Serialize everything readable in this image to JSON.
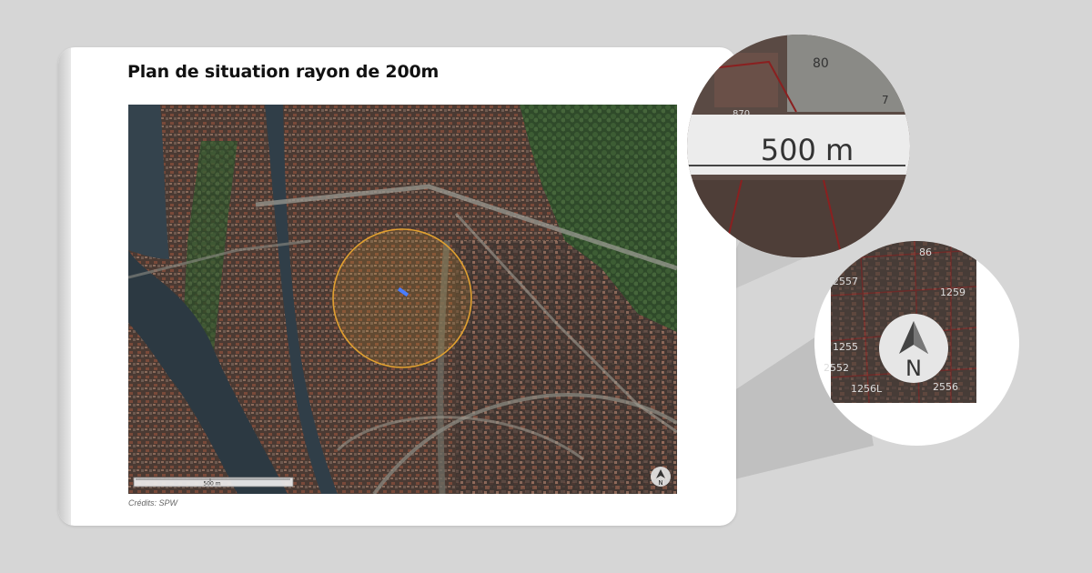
{
  "title": "Plan de situation rayon de 200m",
  "credits": "Crédits: SPW",
  "map": {
    "scale_label": "500 m",
    "north_label": "N",
    "radius_circle_color": "#e0a030",
    "highlight_color": "#4a7dff"
  },
  "zoom_scale": {
    "scale_label": "500 m",
    "parcel_labels": [
      "80",
      "7",
      "870"
    ]
  },
  "zoom_north": {
    "north_label": "N",
    "parcel_labels": [
      "86",
      "2557",
      "2552",
      "1256L",
      "1255",
      "2556",
      "1259"
    ]
  },
  "colors": {
    "page_background": "#d6d6d6",
    "card": "#ffffff",
    "river": "#2f3a42",
    "vegetation": "#3e5a32"
  },
  "icons": [
    "north-arrow-icon"
  ]
}
